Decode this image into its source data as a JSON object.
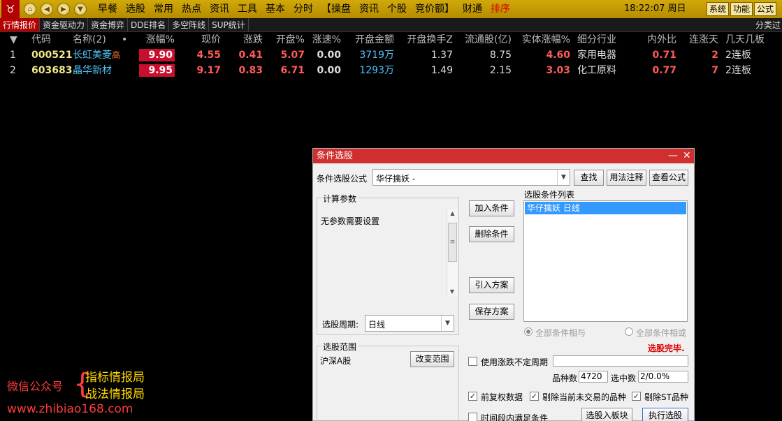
{
  "menubar": {
    "logo_glyph": "♉",
    "nav": {
      "home": "⌂",
      "back": "◀",
      "forward": "▶",
      "down": "▼"
    },
    "items": [
      {
        "label": "早餐",
        "red": false
      },
      {
        "label": "选股",
        "red": false
      },
      {
        "label": "常用",
        "red": false
      },
      {
        "label": "热点",
        "red": false
      },
      {
        "label": "资讯",
        "red": false
      },
      {
        "label": "工具",
        "red": false
      },
      {
        "label": "基本",
        "red": false
      },
      {
        "label": "分时",
        "red": false
      },
      {
        "label": "【操盘",
        "red": false
      },
      {
        "label": "资讯",
        "red": false
      },
      {
        "label": "个股",
        "red": false
      },
      {
        "label": "竞价额】",
        "red": false
      },
      {
        "label": "财通",
        "red": false
      },
      {
        "label": "排序",
        "red": true
      }
    ],
    "clock": "18:22:07 周日",
    "sys_buttons": [
      "系统",
      "功能",
      "公式"
    ]
  },
  "tabbar": {
    "tabs": [
      "行情报价",
      "资金驱动力",
      "资金博弈",
      "DDE排名",
      "多空阵线",
      "SUP统计"
    ],
    "right": "分类过"
  },
  "table": {
    "headers": {
      "sort": "▼",
      "code": "代码",
      "name": "名称(2)",
      "dot": "•",
      "pct": "涨幅%",
      "price": "现价",
      "chg": "涨跌",
      "open": "开盘%",
      "speed": "涨速%",
      "amt": "开盘金额",
      "turn": "开盘换手Z",
      "float": "流通股(亿)",
      "body": "实体涨幅%",
      "ind": "细分行业",
      "io": "内外比",
      "days": "连涨天",
      "boards": "几天几板"
    },
    "rows": [
      {
        "idx": "1",
        "code": "000521",
        "name": "长虹美菱",
        "tag": "高",
        "pct": "9.90",
        "price": "4.55",
        "chg": "0.41",
        "open": "5.07",
        "speed": "0.00",
        "amt": "3719万",
        "turn": "1.37",
        "float": "8.75",
        "body": "4.60",
        "ind": "家用电器",
        "io": "0.71",
        "days": "2",
        "boards": "2连板"
      },
      {
        "idx": "2",
        "code": "603683",
        "name": "晶华新材",
        "tag": "",
        "pct": "9.95",
        "price": "9.17",
        "chg": "0.83",
        "open": "6.71",
        "speed": "0.00",
        "amt": "1293万",
        "turn": "1.49",
        "float": "2.15",
        "body": "3.03",
        "ind": "化工原料",
        "io": "0.77",
        "days": "7",
        "boards": "2连板"
      }
    ]
  },
  "watermark": {
    "left": "微信公众号",
    "brace": "{",
    "right1": "指标情报局",
    "right2": "战法情报局",
    "url": "www.zhibiao168.com"
  },
  "dialog": {
    "title": "条件选股",
    "min_glyph": "—",
    "close_glyph": "✕",
    "formula_label": "条件选股公式",
    "formula_value": "华仔擒妖     -",
    "btn_find": "查找",
    "btn_usage": "用法注释",
    "btn_view": "查看公式",
    "params_group": "计算参数",
    "params_text": "无参数需要设置",
    "period_label": "选股周期:",
    "period_value": "日线",
    "btn_add": "加入条件",
    "btn_delete": "删除条件",
    "btn_import": "引入方案",
    "btn_save": "保存方案",
    "cond_list_label": "选股条件列表",
    "cond_items": [
      "华仔擒妖  日线"
    ],
    "radio_and": "全部条件相与",
    "radio_or": "全部条件相或",
    "status": "选股完毕.",
    "range_group": "选股范围",
    "range_value": "沪深A股",
    "btn_change_range": "改变范围",
    "chk_uncertain": "使用涨跌不定周期",
    "count_label": "品种数",
    "count_value": "4720",
    "selected_label": "选中数",
    "selected_value": "2/0.0%",
    "chk_fq": "前复权数据",
    "chk_exclude_nontrade": "剔除当前未交易的品种",
    "chk_exclude_st": "剔除ST品种",
    "chk_period": "时间段内满足条件",
    "btn_to_block": "选股入板块",
    "btn_execute": "执行选股",
    "check_glyph": "✓",
    "scroll_up": "▲",
    "scroll_down": "▼",
    "combo_arrow": "▼",
    "grip": "≡",
    "status_color": "#e00000"
  }
}
